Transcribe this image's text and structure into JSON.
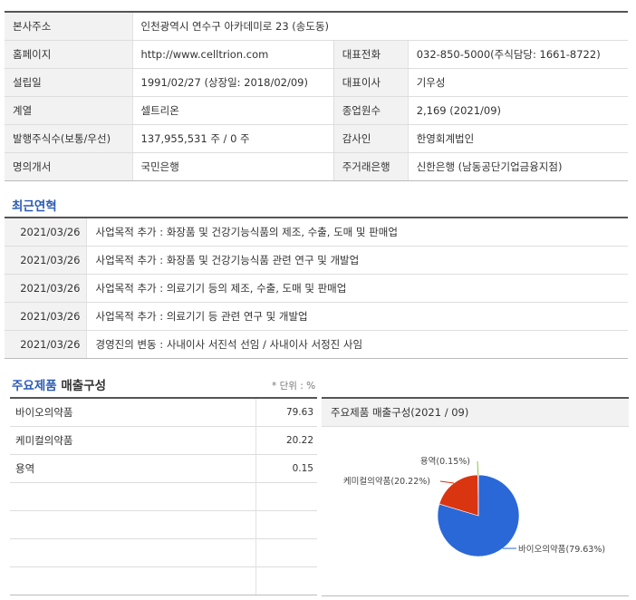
{
  "company_info": [
    {
      "label": "본사주소",
      "value": "인천광역시 연수구 아카데미로 23 (송도동)"
    },
    {
      "label": "홈페이지",
      "value": "http://www.celltrion.com",
      "label2": "대표전화",
      "value2": "032-850-5000(주식담당: 1661-8722)"
    },
    {
      "label": "설립일",
      "value": "1991/02/27 (상장일: 2018/02/09)",
      "label2": "대표이사",
      "value2": "기우성"
    },
    {
      "label": "계열",
      "value": "셀트리온",
      "label2": "종업원수",
      "value2": "2,169 (2021/09)"
    },
    {
      "label": "발행주식수(보통/우선)",
      "value": "137,955,531 주 / 0 주",
      "label2": "감사인",
      "value2": "한영회계법인"
    },
    {
      "label": "명의개서",
      "value": "국민은행",
      "label2": "주거래은행",
      "value2": "신한은행 (남동공단기업금융지점)"
    }
  ],
  "history": {
    "title": "최근연혁",
    "rows": [
      {
        "date": "2021/03/26",
        "text": "사업목적 추가 : 화장품 및 건강기능식품의 제조, 수출, 도매 및 판매업"
      },
      {
        "date": "2021/03/26",
        "text": "사업목적 추가 : 화장품 및 건강기능식품 관련 연구 및 개발업"
      },
      {
        "date": "2021/03/26",
        "text": "사업목적 추가 : 의료기기 등의 제조, 수출, 도매 및 판매업"
      },
      {
        "date": "2021/03/26",
        "text": "사업목적 추가 : 의료기기 등 관련 연구 및 개발업"
      },
      {
        "date": "2021/03/26",
        "text": "경영진의 변동 : 사내이사 서진석 선임 / 사내이사 서정진 사임"
      }
    ]
  },
  "products": {
    "title_highlight": "주요제품",
    "title_rest": "매출구성",
    "unit": "* 단위 : %",
    "rows": [
      {
        "name": "바이오의약품",
        "value": "79.63"
      },
      {
        "name": "케미컬의약품",
        "value": "20.22"
      },
      {
        "name": "용역",
        "value": "0.15"
      },
      {
        "name": "",
        "value": ""
      },
      {
        "name": "",
        "value": ""
      },
      {
        "name": "",
        "value": ""
      },
      {
        "name": "",
        "value": ""
      }
    ]
  },
  "chart_title": "주요제품 매출구성(2021 / 09)",
  "chart_data": {
    "type": "pie",
    "title": "주요제품 매출구성(2021 / 09)",
    "slices": [
      {
        "label": "바이오의약품(79.63%)",
        "value": 79.63,
        "color": "#2a68d8"
      },
      {
        "label": "케미컬의약품(20.22%)",
        "value": 20.22,
        "color": "#d93511"
      },
      {
        "label": "용역(0.15%)",
        "value": 0.15,
        "color": "#8cc63f"
      }
    ]
  }
}
